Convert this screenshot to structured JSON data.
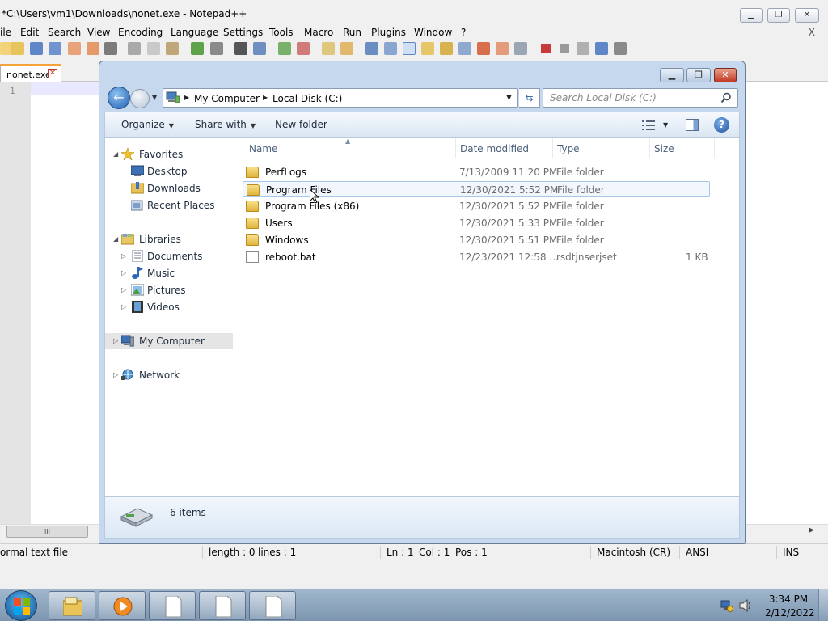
{
  "notepad": {
    "title": "*C:\\Users\\vm1\\Downloads\\nonet.exe - Notepad++",
    "menus": [
      "ile",
      "Edit",
      "Search",
      "View",
      "Encoding",
      "Language",
      "Settings",
      "Tools",
      "Macro",
      "Run",
      "Plugins",
      "Window",
      "?"
    ],
    "menu_close": "X",
    "tab_label": "nonet.exe",
    "tab_close": "✕",
    "line_number": "1",
    "hscroll_thumb": "III",
    "status": {
      "type": "ormal text file",
      "length": "length : 0",
      "lines": "lines : 1",
      "ln": "Ln : 1",
      "col": "Col : 1",
      "pos": "Pos : 1",
      "eol": "Macintosh (CR)",
      "encoding": "ANSI",
      "mode": "INS"
    }
  },
  "explorer": {
    "address": {
      "root": "My Computer",
      "current": "Local Disk (C:)"
    },
    "search_placeholder": "Search Local Disk (C:)",
    "commands": {
      "organize": "Organize",
      "share_with": "Share with",
      "new_folder": "New folder"
    },
    "nav": {
      "favorites": "Favorites",
      "desktop": "Desktop",
      "downloads": "Downloads",
      "recent_places": "Recent Places",
      "libraries": "Libraries",
      "documents": "Documents",
      "music": "Music",
      "pictures": "Pictures",
      "videos": "Videos",
      "my_computer": "My Computer",
      "network": "Network"
    },
    "columns": {
      "name": "Name",
      "date_modified": "Date modified",
      "type": "Type",
      "size": "Size"
    },
    "rows": [
      {
        "name": "PerfLogs",
        "date": "7/13/2009 11:20 PM",
        "type": "File folder",
        "size": ""
      },
      {
        "name": "Program Files",
        "date": "12/30/2021 5:52 PM",
        "type": "File folder",
        "size": ""
      },
      {
        "name": "Program Files (x86)",
        "date": "12/30/2021 5:52 PM",
        "type": "File folder",
        "size": ""
      },
      {
        "name": "Users",
        "date": "12/30/2021 5:33 PM",
        "type": "File folder",
        "size": ""
      },
      {
        "name": "Windows",
        "date": "12/30/2021 5:51 PM",
        "type": "File folder",
        "size": ""
      },
      {
        "name": "reboot.bat",
        "date": "12/23/2021 12:58 ...",
        "type": "rsdtjnserjset",
        "size": "1 KB"
      }
    ],
    "item_count": "6 items"
  },
  "taskbar": {
    "time": "3:34 PM",
    "date": "2/12/2022"
  },
  "colors": {
    "explorer_frame": "#c6d8ee",
    "tab_accent": "#f3a33a",
    "hover_row_border": "#a6c6ea",
    "taskbar": "#8aa3bd"
  }
}
